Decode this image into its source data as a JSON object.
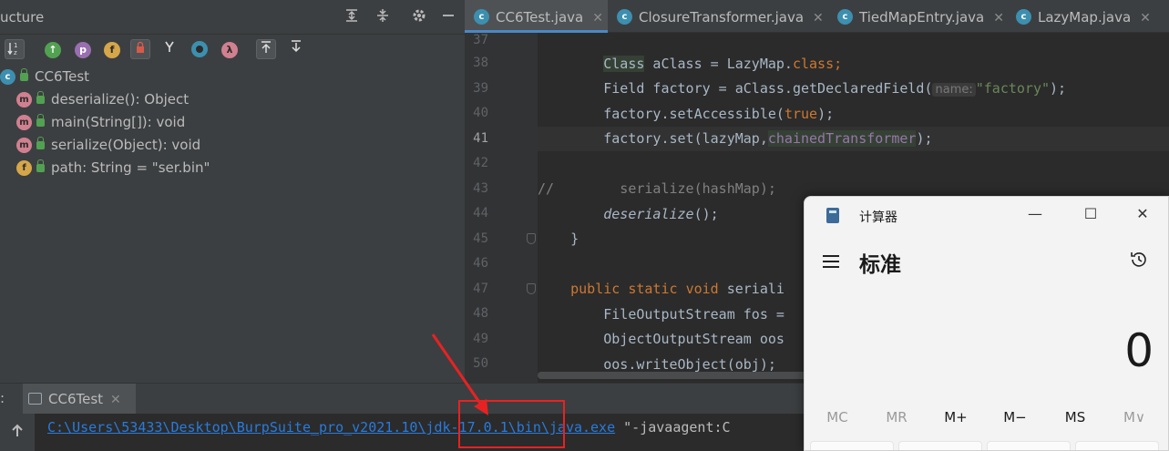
{
  "structure": {
    "title": "ucture",
    "class_name": "CC6Test",
    "members": [
      {
        "kind": "m",
        "label": "deserialize(): Object"
      },
      {
        "kind": "m",
        "label": "main(String[]): void"
      },
      {
        "kind": "m",
        "label": "serialize(Object): void"
      },
      {
        "kind": "f",
        "label": "path: String = \"ser.bin\""
      }
    ],
    "toolbar_icons": [
      "sort-alpha-icon",
      "inherited-icon",
      "show-properties-icon",
      "show-fields-icon",
      "non-public-icon",
      "lambdas-icon",
      "anonymous-icon",
      "lambda-icon",
      "autoscroll-to-source-icon",
      "autoscroll-from-source-icon"
    ]
  },
  "editor": {
    "tabs": [
      {
        "label": "CC6Test.java",
        "active": true,
        "closable": true
      },
      {
        "label": "ClosureTransformer.java",
        "active": false,
        "closable": true
      },
      {
        "label": "TiedMapEntry.java",
        "active": false,
        "closable": true
      },
      {
        "label": "LazyMap.java",
        "active": false,
        "closable": true
      }
    ],
    "close_glyph": "✕",
    "current_line": "41",
    "lines": [
      {
        "num": "37"
      },
      {
        "num": "38",
        "a": "Class",
        "b": " aClass = LazyMap.",
        "c": "class",
        "d": ";"
      },
      {
        "num": "39",
        "a": "Field factory = aClass.getDeclaredField(",
        "hint": "name:",
        "str": "\"factory\"",
        "end": ");"
      },
      {
        "num": "40",
        "a": "factory.setAccessible(",
        "kw": "true",
        "end": ");"
      },
      {
        "num": "41",
        "a": "factory.set(lazyMap,",
        "fld": "chainedTransformer",
        "end": ");"
      },
      {
        "num": "42"
      },
      {
        "num": "43",
        "cmt": "//        serialize(hashMap);"
      },
      {
        "num": "44",
        "a": "deserialize",
        "end": "();"
      },
      {
        "num": "45",
        "a": "}"
      },
      {
        "num": "46"
      },
      {
        "num": "47",
        "kw1": "public",
        "kw2": "static",
        "kw3": "void",
        "rest": "seriali"
      },
      {
        "num": "48",
        "a": "FileOutputStream fos ="
      },
      {
        "num": "49",
        "a": "ObjectOutputStream oos"
      },
      {
        "num": "50",
        "a": "oos.writeObject(obj);"
      }
    ]
  },
  "run": {
    "prefix": ":",
    "tab_label": "CC6Test",
    "close_glyph": "✕",
    "command_link": "C:\\Users\\53433\\Desktop\\BurpSuite_pro_v2021.10\\jdk-17.0.1\\bin\\java.exe",
    "command_rest": " \"-javaagent:C"
  },
  "calculator": {
    "title": "计算器",
    "mode": "标准",
    "display": "0",
    "memory_buttons": [
      {
        "label": "MC",
        "enabled": false
      },
      {
        "label": "MR",
        "enabled": false
      },
      {
        "label": "M+",
        "enabled": true
      },
      {
        "label": "M−",
        "enabled": true
      },
      {
        "label": "MS",
        "enabled": true
      },
      {
        "label": "M∨",
        "enabled": false
      }
    ],
    "window_buttons": {
      "minimize": "—",
      "maximize": "☐",
      "close": "✕"
    }
  },
  "colors": {
    "annotation_red": "#e82222",
    "accent_blue": "#4a88c7",
    "keyword": "#cc7832",
    "string": "#6a8759",
    "field": "#9876aa",
    "link": "#287bde"
  }
}
